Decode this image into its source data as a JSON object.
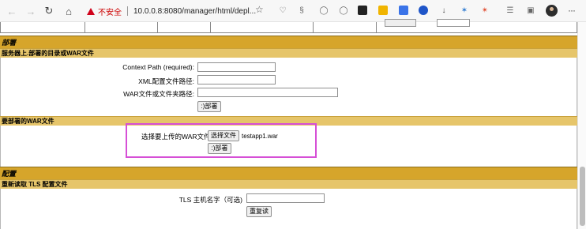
{
  "browser": {
    "security_label": "不安全",
    "url": "10.0.0.8:8080/manager/html/depl...",
    "icons": [
      "back-icon",
      "forward-icon",
      "reload-icon",
      "home-icon",
      "star-icon",
      "extensions-icon",
      "avatar-icon",
      "menu-icon"
    ]
  },
  "deploy": {
    "section_title": "部署",
    "server_dir_title": "服务器上.部署的目录或WAR文件",
    "context_path_label": "Context Path (required):",
    "xml_config_label": "XML配置文件路径:",
    "war_dir_label": "WAR文件或文件夹路径:",
    "context_path_value": "",
    "xml_config_value": "",
    "war_dir_value": "",
    "deploy_button": ":)部署",
    "upload_title": "要部署的WAR文件",
    "upload_label": "选择要上传的WAR文件",
    "choose_file_button": "选择文件",
    "chosen_file": "testapp1.war",
    "upload_deploy_button": ":)部署"
  },
  "config": {
    "section_title": "配置",
    "tls_title": "重新读取 TLS 配置文件",
    "tls_host_label": "TLS 主机名字（可选)",
    "tls_host_value": "",
    "reload_button": "重复读"
  },
  "colors": {
    "section_bg": "#d6a52b",
    "subsection_bg": "#e6c56a",
    "highlight_border": "#d64fd6",
    "warning": "#d0021b"
  }
}
